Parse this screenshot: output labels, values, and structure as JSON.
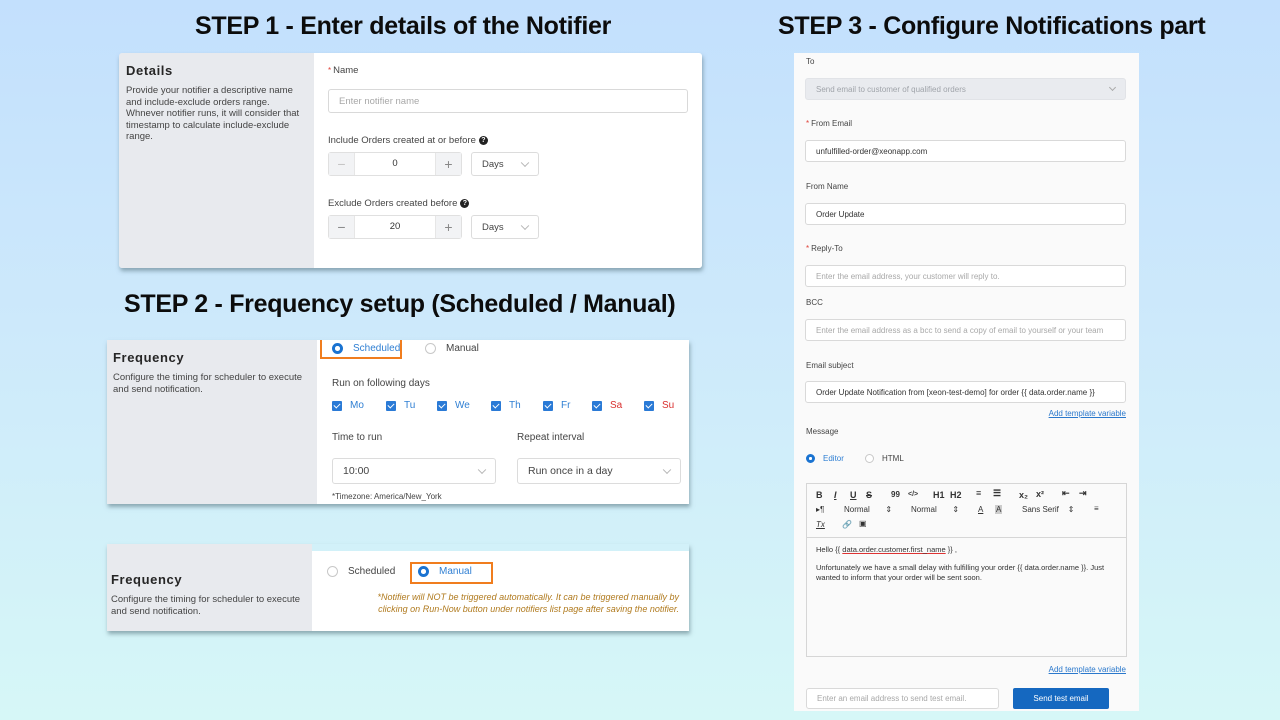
{
  "titles": {
    "step1": "STEP 1 - Enter details of the Notifier",
    "step2": "STEP 2 - Frequency setup (Scheduled / Manual)",
    "step3": "STEP 3  - Configure Notifications part"
  },
  "details": {
    "heading": "Details",
    "description": "Provide your notifier a descriptive name and include-exclude orders range. Whnever notifier runs, it will consider that timestamp to calculate include-exclude range.",
    "name_label": "Name",
    "name_placeholder": "Enter notifier name",
    "include_label": "Include Orders created at or before",
    "include_value": "0",
    "include_unit": "Days",
    "exclude_label": "Exclude Orders created before",
    "exclude_value": "20",
    "exclude_unit": "Days",
    "help_glyph": "?"
  },
  "frequency_scheduled": {
    "heading": "Frequency",
    "description": "Configure the timing for scheduler to execute and send notification.",
    "options": [
      "Scheduled",
      "Manual"
    ],
    "selected": "Scheduled",
    "days_label": "Run on following days",
    "days": [
      {
        "label": "Mo",
        "checked": true,
        "weekend": false
      },
      {
        "label": "Tu",
        "checked": true,
        "weekend": false
      },
      {
        "label": "We",
        "checked": true,
        "weekend": false
      },
      {
        "label": "Th",
        "checked": true,
        "weekend": false
      },
      {
        "label": "Fr",
        "checked": true,
        "weekend": false
      },
      {
        "label": "Sa",
        "checked": true,
        "weekend": true
      },
      {
        "label": "Su",
        "checked": true,
        "weekend": true
      }
    ],
    "time_label": "Time to run",
    "time_value": "10:00",
    "repeat_label": "Repeat interval",
    "repeat_value": "Run once in a day",
    "timezone_note": "*Timezone: America/New_York"
  },
  "frequency_manual": {
    "heading": "Frequency",
    "description": "Configure the timing for scheduler to execute and send notification.",
    "options": [
      "Scheduled",
      "Manual"
    ],
    "selected": "Manual",
    "note_line1": "*Notifier will NOT be triggered automatically. It can be triggered manually by",
    "note_line2": "clicking on Run-Now button under notifiers list page after saving the notifier."
  },
  "notification": {
    "to_label": "To",
    "to_value": "Send email to customer of qualified orders",
    "from_email_label": "From Email",
    "from_email_value": "unfulfilled-order@xeonapp.com",
    "from_name_label": "From Name",
    "from_name_value": "Order Update",
    "reply_to_label": "Reply-To",
    "reply_to_placeholder": "Enter the email address, your customer will reply to.",
    "bcc_label": "BCC",
    "bcc_placeholder": "Enter the email address as a bcc to send a copy of email to yourself or your team",
    "subject_label": "Email subject",
    "subject_value": "Order Update Notification from [xeon-test-demo] for order {{ data.order.name }}",
    "add_template_variable": "Add template variable",
    "message_label": "Message",
    "message_modes": [
      "Editor",
      "HTML"
    ],
    "message_mode_selected": "Editor",
    "toolbar": {
      "bold": "B",
      "italic": "I",
      "underline": "U",
      "strike": "S",
      "quote": "99",
      "code": "</>",
      "h1": "H1",
      "h2": "H2",
      "ordered_list": "ordered-list-icon",
      "bullet_list": "bullet-list-icon",
      "subscript": "x₂",
      "superscript": "x²",
      "indent_out": "outdent-icon",
      "indent_in": "indent-icon",
      "direction": "▸¶",
      "size_select": "Normal",
      "header_select": "Normal",
      "font_color": "A",
      "background": "A",
      "font_select": "Sans Serif",
      "align": "align-icon",
      "clean": "Tx",
      "link": "link-icon",
      "image": "image-icon"
    },
    "body_greeting_prefix": "Hello {{ ",
    "body_greeting_var": "data.order.customer.first_name",
    "body_greeting_suffix": " }} ,",
    "body_paragraph": "Unfortunately we have a small delay with fulfilling your order {{ data.order.name }}. Just wanted to inform that your order will be sent soon.",
    "test_email_placeholder": "Enter an email address to send test email.",
    "send_test_button": "Send test email"
  },
  "colors": {
    "accent_blue": "#1a73d1",
    "highlight_orange": "#f07d1e",
    "weekend_red": "#d9302f",
    "note_amber": "#b07a1e",
    "button_blue": "#1568c0"
  }
}
